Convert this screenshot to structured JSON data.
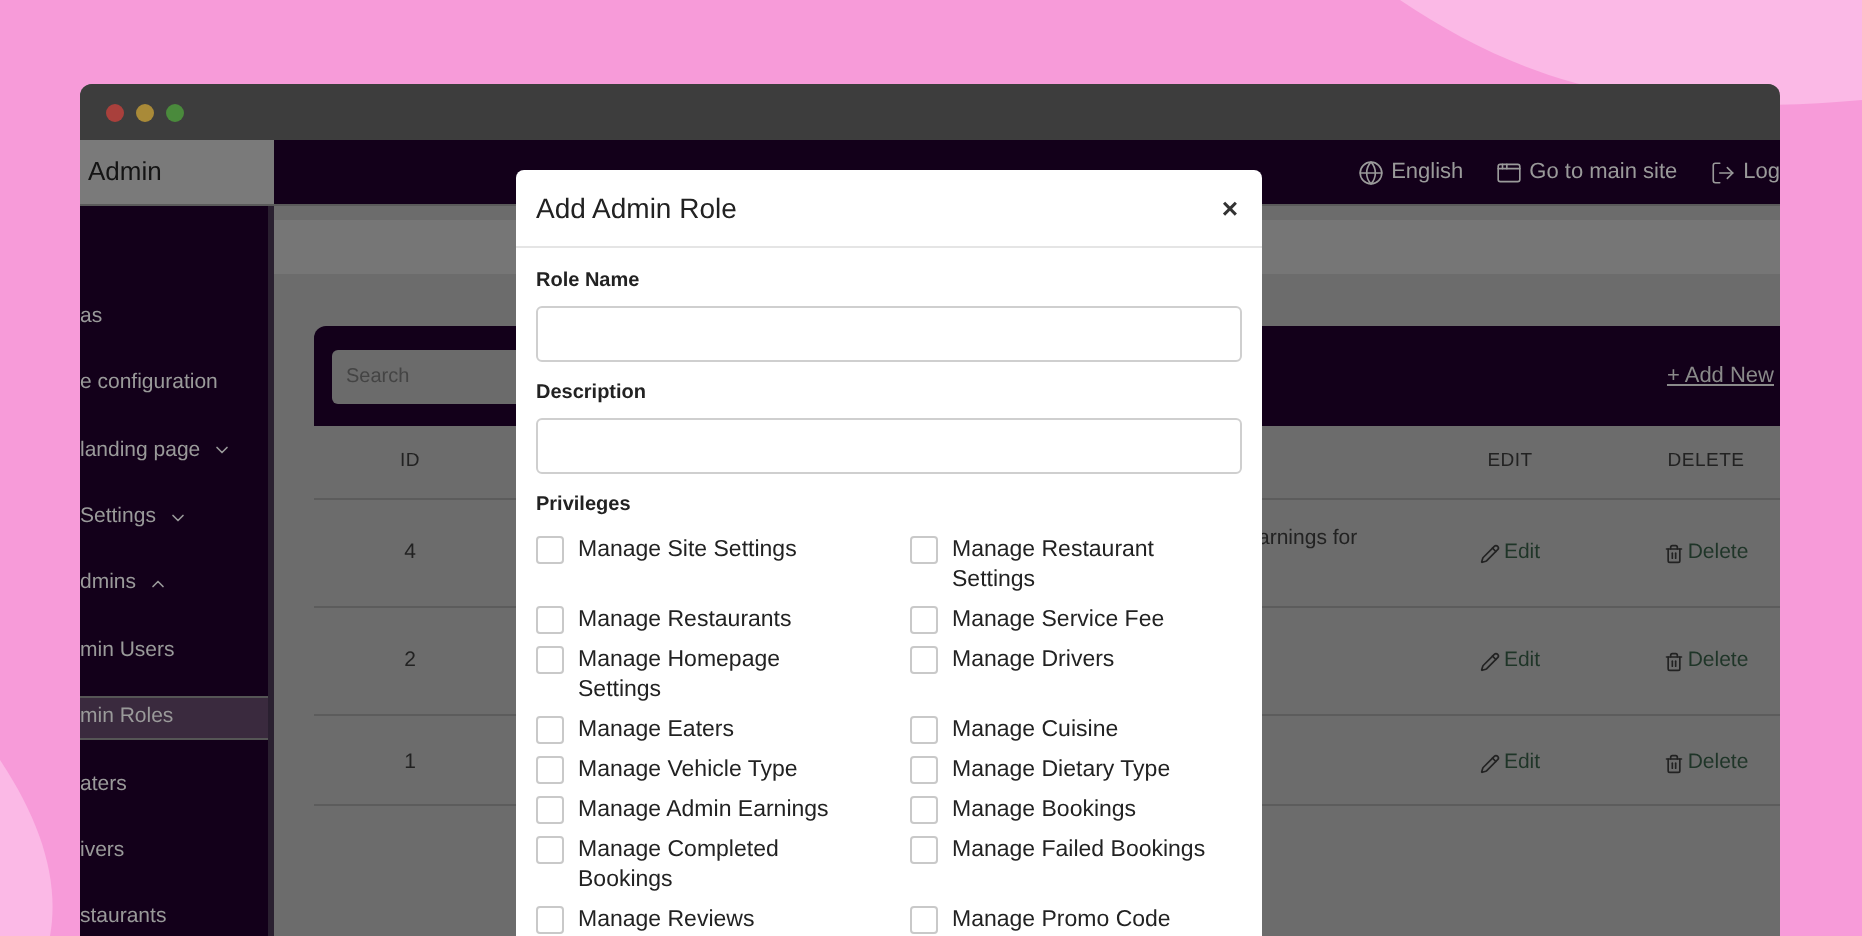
{
  "header": {
    "brand": "Admin",
    "links": [
      {
        "kind": "language",
        "label": "English"
      },
      {
        "kind": "site",
        "label": "Go to main site"
      },
      {
        "kind": "logout",
        "label": "Log"
      }
    ]
  },
  "sidebar": {
    "items": [
      {
        "label": "as",
        "selected": false
      },
      {
        "label": "e configuration",
        "selected": false
      },
      {
        "label": "landing page",
        "selected": false,
        "expanded": false
      },
      {
        "label": "Settings",
        "selected": false,
        "expanded": false
      },
      {
        "label": "dmins",
        "selected": false,
        "expanded": true
      },
      {
        "label": "min Users",
        "selected": false
      },
      {
        "label": "min Roles",
        "selected": true
      },
      {
        "label": "aters",
        "selected": false
      },
      {
        "label": "ivers",
        "selected": false
      },
      {
        "label": "staurants",
        "selected": false
      }
    ]
  },
  "card": {
    "search": {
      "placeholder": "Search"
    },
    "add_button": "+ Add New"
  },
  "table": {
    "columns": [
      "ID",
      "EDIT",
      "DELETE"
    ],
    "rows": [
      {
        "id": "4",
        "description": "arnings for",
        "edit": "Edit",
        "delete": "Delete"
      },
      {
        "id": "2",
        "edit": "Edit",
        "delete": "Delete"
      },
      {
        "id": "1",
        "edit": "Edit",
        "delete": "Delete"
      }
    ]
  },
  "modal": {
    "title": "Add Admin Role",
    "close": "×",
    "fields": [
      {
        "label": "Role Name"
      },
      {
        "label": "Description"
      }
    ],
    "privileges_label": "Privileges",
    "privileges": [
      {
        "label": "Manage Site Settings",
        "checked": false
      },
      {
        "label": "Manage Restaurant Settings",
        "checked": false
      },
      {
        "label": "Manage Restaurants",
        "checked": false
      },
      {
        "label": "Manage Service Fee",
        "checked": false
      },
      {
        "label": "Manage Homepage Settings",
        "checked": false
      },
      {
        "label": "Manage Drivers",
        "checked": false
      },
      {
        "label": "Manage Eaters",
        "checked": false
      },
      {
        "label": "Manage Cuisine",
        "checked": false
      },
      {
        "label": "Manage Vehicle Type",
        "checked": false
      },
      {
        "label": "Manage Dietary Type",
        "checked": false
      },
      {
        "label": "Manage Admin Earnings",
        "checked": false
      },
      {
        "label": "Manage Bookings",
        "checked": false
      },
      {
        "label": "Manage Completed Bookings",
        "checked": false
      },
      {
        "label": "Manage Failed Bookings",
        "checked": false
      },
      {
        "label": "Manage Reviews",
        "checked": false
      },
      {
        "label": "Manage Promo Code",
        "checked": false
      }
    ]
  }
}
